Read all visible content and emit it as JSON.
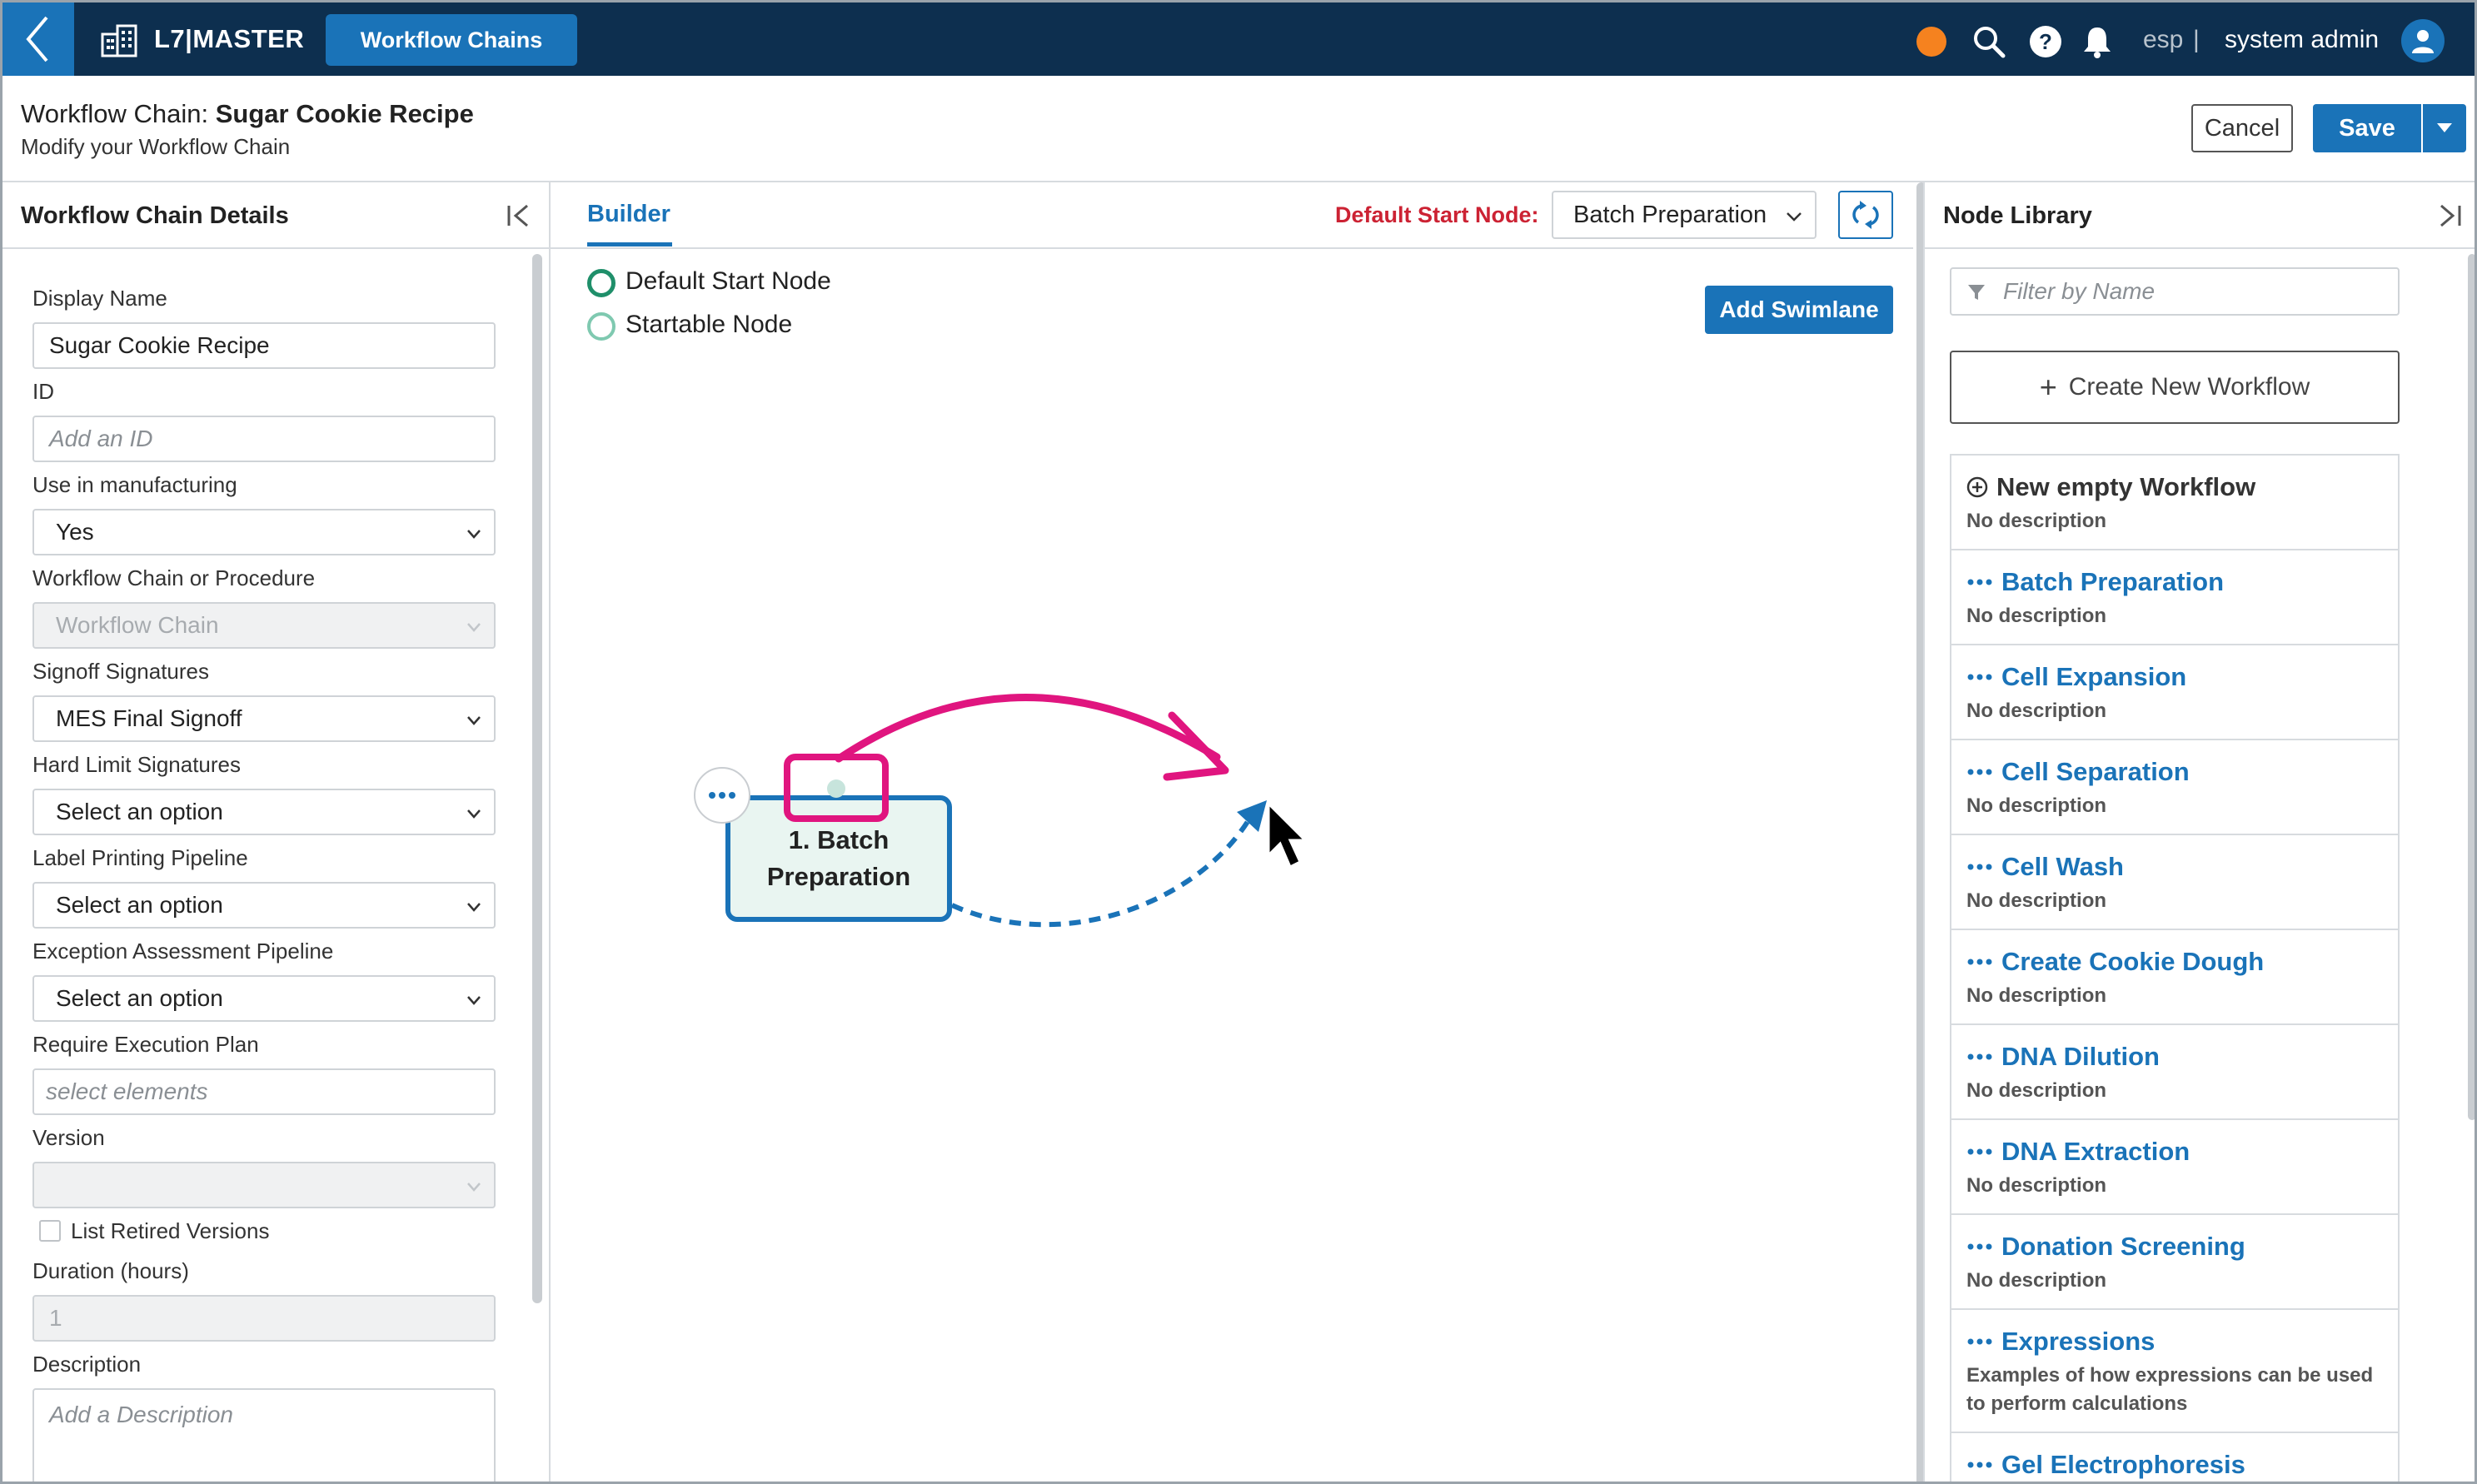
{
  "topbar": {
    "brand": "L7|MASTER",
    "active_tab": "Workflow Chains",
    "language": "esp",
    "separator": "|",
    "user_name": "system admin"
  },
  "header": {
    "title_prefix": "Workflow Chain:",
    "title_name": "Sugar Cookie Recipe",
    "subtitle": "Modify your Workflow Chain",
    "cancel_label": "Cancel",
    "save_label": "Save"
  },
  "details": {
    "heading": "Workflow Chain Details",
    "fields": {
      "display_name": {
        "label": "Display Name",
        "value": "Sugar Cookie Recipe"
      },
      "id": {
        "label": "ID",
        "placeholder": "Add an ID"
      },
      "use_in_manufacturing": {
        "label": "Use in manufacturing",
        "value": "Yes"
      },
      "chain_or_procedure": {
        "label": "Workflow Chain or Procedure",
        "value": "Workflow Chain"
      },
      "signoff_signatures": {
        "label": "Signoff Signatures",
        "value": "MES Final Signoff"
      },
      "hard_limit_signatures": {
        "label": "Hard Limit Signatures",
        "value": "Select an option"
      },
      "label_printing_pipeline": {
        "label": "Label Printing Pipeline",
        "value": "Select an option"
      },
      "exception_assessment_pipeline": {
        "label": "Exception Assessment Pipeline",
        "value": "Select an option"
      },
      "require_execution_plan": {
        "label": "Require Execution Plan",
        "placeholder": "select elements"
      },
      "version": {
        "label": "Version",
        "value": ""
      },
      "list_retired_versions": {
        "label": "List Retired Versions",
        "checked": false
      },
      "duration": {
        "label": "Duration (hours)",
        "value": "1"
      },
      "description": {
        "label": "Description",
        "placeholder": "Add a Description"
      }
    }
  },
  "builder": {
    "tab_label": "Builder",
    "default_start_label": "Default Start Node:",
    "default_start_value": "Batch Preparation",
    "legend": {
      "default_start": "Default Start Node",
      "startable": "Startable Node"
    },
    "add_swimlane_label": "Add Swimlane",
    "node": {
      "line1": "1. Batch",
      "line2": "Preparation"
    },
    "colors": {
      "accent": "#1a73b8",
      "annotation": "#e0157f",
      "default_start_ring": "#1f8f6a",
      "startable_ring": "#7fc9b0",
      "node_fill": "#e9f5f1"
    }
  },
  "library": {
    "heading": "Node Library",
    "filter_placeholder": "Filter by Name",
    "create_label": "Create New Workflow",
    "items": [
      {
        "title": "New empty Workflow",
        "desc": "No description",
        "icon": "add-circle-icon"
      },
      {
        "title": "Batch Preparation",
        "desc": "No description",
        "icon": "more-dots-icon"
      },
      {
        "title": "Cell Expansion",
        "desc": "No description",
        "icon": "more-dots-icon"
      },
      {
        "title": "Cell Separation",
        "desc": "No description",
        "icon": "more-dots-icon"
      },
      {
        "title": "Cell Wash",
        "desc": "No description",
        "icon": "more-dots-icon"
      },
      {
        "title": "Create Cookie Dough",
        "desc": "No description",
        "icon": "more-dots-icon"
      },
      {
        "title": "DNA Dilution",
        "desc": "No description",
        "icon": "more-dots-icon"
      },
      {
        "title": "DNA Extraction",
        "desc": "No description",
        "icon": "more-dots-icon"
      },
      {
        "title": "Donation Screening",
        "desc": "No description",
        "icon": "more-dots-icon"
      },
      {
        "title": "Expressions",
        "desc": "Examples of how expressions can be used to perform calculations",
        "icon": "more-dots-icon"
      },
      {
        "title": "Gel Electrophoresis",
        "desc": "",
        "icon": "more-dots-icon"
      }
    ]
  }
}
